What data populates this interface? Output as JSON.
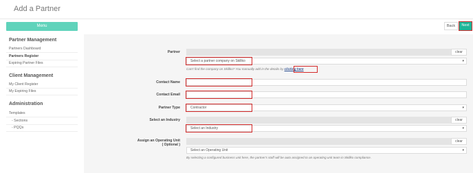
{
  "header": {
    "title": "Add a Partner"
  },
  "sidebar": {
    "menu_label": "Menu",
    "sections": [
      {
        "title": "Partner Management",
        "items": [
          "Partners Dashboard",
          "Partners Register",
          "Expiring Partner Files"
        ]
      },
      {
        "title": "Client Management",
        "items": [
          "My Client Register",
          "My Expiring Files"
        ]
      },
      {
        "title": "Administration",
        "items": [
          "Templates",
          "- Sections",
          "- PQQs"
        ]
      }
    ]
  },
  "toolbar": {
    "back_label": "Back",
    "next_label": "Next"
  },
  "form": {
    "partner": {
      "label": "Partner",
      "clear": "clear",
      "placeholder": "Select a partner company on Skillko",
      "hint": "Can't find the company on Skillko? You manually add in the details by ",
      "hint_link": "clicking here"
    },
    "contact_name": {
      "label": "Contact Name"
    },
    "contact_email": {
      "label": "Contact Email"
    },
    "partner_type": {
      "label": "Partner Type",
      "value": "Contractor"
    },
    "industry": {
      "label": "Select an Industry",
      "clear": "clear",
      "placeholder": "Select an Industry"
    },
    "operating_unit": {
      "label": "Assign an Operating Unit",
      "label_optional": "( Optional )",
      "clear": "clear",
      "placeholder": "Select an Operating Unit",
      "hint": "By selecting a configured business unit here, the partner's staff will be auto assigned to an operating unit team in Skillko compliance."
    }
  }
}
